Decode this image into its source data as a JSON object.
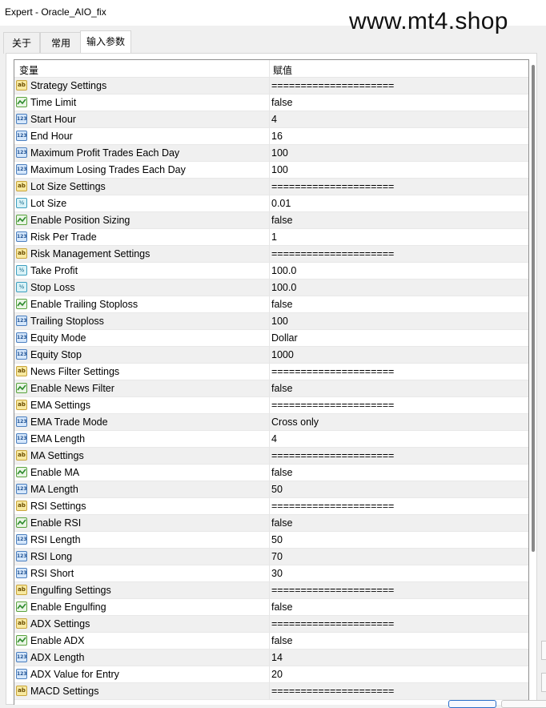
{
  "window": {
    "title": "Expert - Oracle_AIO_fix",
    "watermark": "www.mt4.shop"
  },
  "tabs": [
    {
      "label": "关于",
      "active": false
    },
    {
      "label": "常用",
      "active": false
    },
    {
      "label": "输入参数",
      "active": true
    }
  ],
  "grid": {
    "headers": {
      "variable": "变量",
      "value": "赋值"
    },
    "rows": [
      {
        "name": "Strategy Settings",
        "value": "=====================",
        "icon": "string-icon"
      },
      {
        "name": "Time Limit",
        "value": "false",
        "icon": "bool-icon"
      },
      {
        "name": "Start Hour",
        "value": "4",
        "icon": "int-icon"
      },
      {
        "name": "End Hour",
        "value": "16",
        "icon": "int-icon"
      },
      {
        "name": "Maximum Profit Trades Each Day",
        "value": "100",
        "icon": "int-icon"
      },
      {
        "name": "Maximum Losing Trades Each Day",
        "value": "100",
        "icon": "int-icon"
      },
      {
        "name": "Lot Size Settings",
        "value": "=====================",
        "icon": "string-icon"
      },
      {
        "name": "Lot Size",
        "value": "0.01",
        "icon": "double-icon"
      },
      {
        "name": "Enable Position Sizing",
        "value": "false",
        "icon": "bool-icon"
      },
      {
        "name": "Risk Per Trade",
        "value": "1",
        "icon": "int-icon"
      },
      {
        "name": "Risk Management Settings",
        "value": "=====================",
        "icon": "string-icon"
      },
      {
        "name": "Take Profit",
        "value": "100.0",
        "icon": "double-icon"
      },
      {
        "name": "Stop Loss",
        "value": "100.0",
        "icon": "double-icon"
      },
      {
        "name": "Enable Trailing Stoploss",
        "value": "false",
        "icon": "bool-icon"
      },
      {
        "name": "Trailing Stoploss",
        "value": "100",
        "icon": "int-icon"
      },
      {
        "name": "Equity Mode",
        "value": "Dollar",
        "icon": "int-icon"
      },
      {
        "name": "Equity Stop",
        "value": "1000",
        "icon": "int-icon"
      },
      {
        "name": "News Filter Settings",
        "value": "=====================",
        "icon": "string-icon"
      },
      {
        "name": "Enable News Filter",
        "value": "false",
        "icon": "bool-icon"
      },
      {
        "name": "EMA Settings",
        "value": "=====================",
        "icon": "string-icon"
      },
      {
        "name": "EMA Trade Mode",
        "value": "Cross only",
        "icon": "int-icon"
      },
      {
        "name": "EMA Length",
        "value": "4",
        "icon": "int-icon"
      },
      {
        "name": "MA Settings",
        "value": "=====================",
        "icon": "string-icon"
      },
      {
        "name": "Enable MA",
        "value": "false",
        "icon": "bool-icon"
      },
      {
        "name": "MA Length",
        "value": "50",
        "icon": "int-icon"
      },
      {
        "name": "RSI Settings",
        "value": "=====================",
        "icon": "string-icon"
      },
      {
        "name": "Enable RSI",
        "value": "false",
        "icon": "bool-icon"
      },
      {
        "name": "RSI Length",
        "value": "50",
        "icon": "int-icon"
      },
      {
        "name": "RSI Long",
        "value": "70",
        "icon": "int-icon"
      },
      {
        "name": "RSI Short",
        "value": "30",
        "icon": "int-icon"
      },
      {
        "name": "Engulfing Settings",
        "value": "=====================",
        "icon": "string-icon"
      },
      {
        "name": "Enable Engulfing",
        "value": "false",
        "icon": "bool-icon"
      },
      {
        "name": "ADX Settings",
        "value": "=====================",
        "icon": "string-icon"
      },
      {
        "name": "Enable ADX",
        "value": "false",
        "icon": "bool-icon"
      },
      {
        "name": "ADX Length",
        "value": "14",
        "icon": "int-icon"
      },
      {
        "name": "ADX Value for Entry",
        "value": "20",
        "icon": "int-icon"
      },
      {
        "name": "MACD Settings",
        "value": "=====================",
        "icon": "string-icon"
      }
    ]
  },
  "icon_glyphs": {
    "string-icon": "ab",
    "bool-icon": "",
    "int-icon": "123",
    "double-icon": "½"
  },
  "colors": {
    "row_alt": "#f0f0f0",
    "row": "#ffffff",
    "bool_icon_line": "#2e8b2e"
  }
}
